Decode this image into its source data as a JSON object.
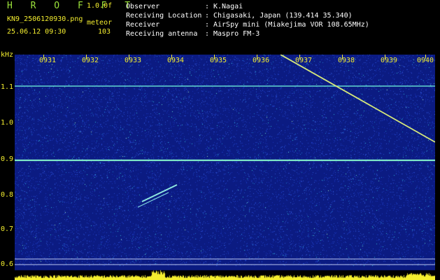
{
  "header": {
    "title": "H R O F F T",
    "version": "1.0.0f",
    "filename": "KN9_2506120930.png",
    "datetime": "25.06.12 09:30",
    "mode_label": "meteor",
    "count": "103",
    "info": [
      {
        "key": "Observer",
        "value": "K.Nagai"
      },
      {
        "key": "Receiving Location",
        "value": "Chigasaki, Japan (139.414 35.340)"
      },
      {
        "key": "Receiver",
        "value": "AirSpy mini (Miakejima VOR 108.65MHz)"
      },
      {
        "key": "Receiving antenna",
        "value": "Maspro FM-3"
      }
    ]
  },
  "axis": {
    "unit": "kHz",
    "freq_labels": [
      "1.1",
      "1.0",
      "0.9",
      "0.8",
      "0.7",
      "0.6"
    ],
    "time_labels": [
      "0931",
      "0932",
      "0933",
      "0934",
      "0935",
      "0936",
      "0937",
      "0938",
      "0939",
      "0940"
    ]
  },
  "colors": {
    "accent": "#f4ee2f",
    "title": "#9be23b",
    "background": "#0b1b82",
    "signal": "#7fe8c7"
  }
}
